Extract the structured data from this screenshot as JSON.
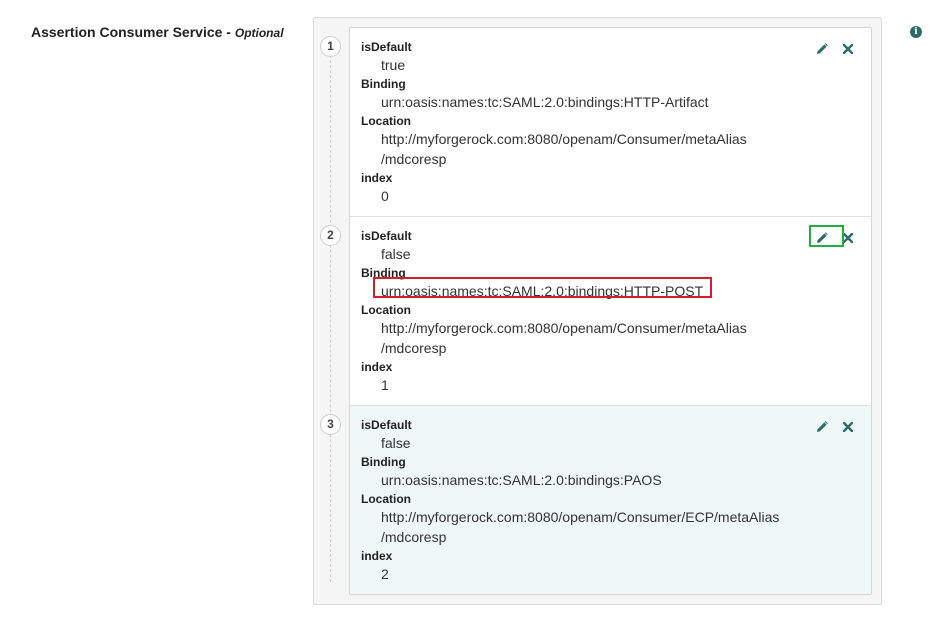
{
  "field": {
    "label": "Assertion Consumer Service",
    "separator": " - ",
    "optional": "Optional"
  },
  "labels": {
    "isDefault": "isDefault",
    "binding": "Binding",
    "location": "Location",
    "index": "index"
  },
  "items": [
    {
      "number": "1",
      "isDefault": "true",
      "binding": "urn:oasis:names:tc:SAML:2.0:bindings:HTTP-Artifact",
      "location_line1": "http://myforgerock.com:8080/openam/Consumer/metaAlias",
      "location_line2": "/mdcoresp",
      "index": "0"
    },
    {
      "number": "2",
      "isDefault": "false",
      "binding": "urn:oasis:names:tc:SAML:2.0:bindings:HTTP-POST",
      "location_line1": "http://myforgerock.com:8080/openam/Consumer/metaAlias",
      "location_line2": "/mdcoresp",
      "index": "1"
    },
    {
      "number": "3",
      "isDefault": "false",
      "binding": "urn:oasis:names:tc:SAML:2.0:bindings:PAOS",
      "location_line1": "http://myforgerock.com:8080/openam/Consumer/ECP/metaAlias",
      "location_line2": "/mdcoresp",
      "index": "2"
    }
  ],
  "icons": {
    "edit": "pencil-icon",
    "delete": "close-icon",
    "info": "info-icon"
  },
  "colors": {
    "accent": "#2e6b66",
    "highlight_red": "#d0222a",
    "highlight_green": "#27a844",
    "active_row_bg": "#eef8f6"
  }
}
